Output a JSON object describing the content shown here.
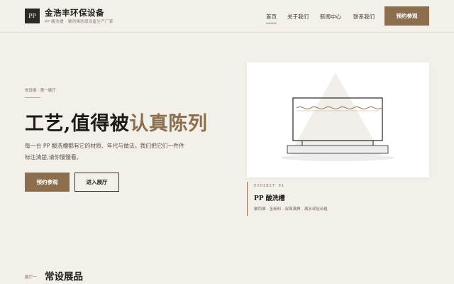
{
  "brand": {
    "logo_text": "PP",
    "name": "金浩丰环保设备",
    "tagline": "PP 酸洗槽 · 聚丙烯防腐设备生产厂家"
  },
  "nav": {
    "items": [
      {
        "label": "首页",
        "active": true
      },
      {
        "label": "关于我们",
        "active": false
      },
      {
        "label": "新闻中心",
        "active": false
      },
      {
        "label": "联系我们",
        "active": false
      }
    ],
    "cta_label": "预约参观"
  },
  "hero": {
    "breadcrumb": "常设展 · 第一展厅",
    "title_plain": "工艺,值得被",
    "title_accent": "认真陈列",
    "description": "每一台 PP 酸洗槽都有它的材质、年代与做法。我们把它们一件件标注清楚,请你慢慢看。",
    "primary_button": "预约参观",
    "secondary_button": "进入展厅"
  },
  "exhibit": {
    "number": "EXHIBIT 01",
    "name": "PP 酸洗槽",
    "tags": "聚丙烯 · 全新料 · 双面满焊 · 满水试验合格",
    "illustration_icon": "acid-tank-illustration"
  },
  "section": {
    "kicker": "展厅一",
    "title": "常设展品"
  },
  "colors": {
    "accent": "#8b6e4e",
    "background": "#f3efe9",
    "dark": "#2d2925"
  }
}
